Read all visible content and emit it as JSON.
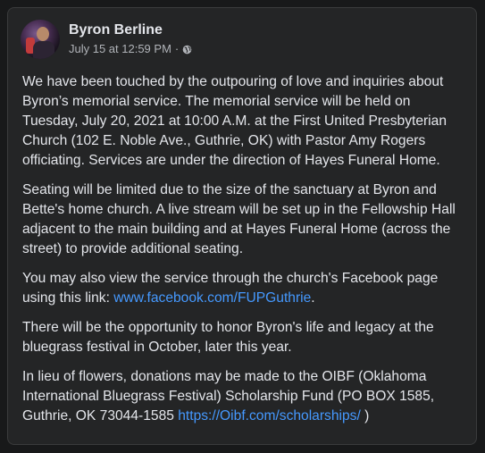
{
  "post": {
    "author": "Byron Berline",
    "timestamp": "July 15 at 12:59 PM",
    "separator": "·",
    "privacy_icon": "globe-icon",
    "paragraphs": {
      "p1": "We have been touched by the outpouring of love and inquiries about Byron’s memorial service. The memorial service will be held on Tuesday, July 20, 2021 at 10:00 A.M. at the First United Presbyterian Church (102 E. Noble Ave., Guthrie, OK) with Pastor Amy Rogers officiating. Services are under the direction of Hayes Funeral Home.",
      "p2": "Seating will be limited due to the size of the sanctuary at Byron and Bette's home church. A live stream will be set up in the Fellowship Hall adjacent to the main building and at Hayes Funeral Home (across the street) to provide additional seating.",
      "p3_text": "You may also view the service through the church's Facebook page using this link: ",
      "p3_link": "www.facebook.com/FUPGuthrie",
      "p3_end": ".",
      "p4": "There will be the opportunity to honor Byron's life and legacy at the bluegrass festival in October, later this year.",
      "p5_text": "In lieu of flowers, donations may be made to the OIBF (Oklahoma International Bluegrass Festival) Scholarship Fund (PO BOX 1585, Guthrie, OK 73044-1585 ",
      "p5_link": "https://Oibf.com/scholarships/",
      "p5_end": " )"
    }
  },
  "colors": {
    "background": "#18191a",
    "card": "#242526",
    "text": "#e4e6eb",
    "secondary_text": "#b0b3b8",
    "link": "#4599ff"
  }
}
